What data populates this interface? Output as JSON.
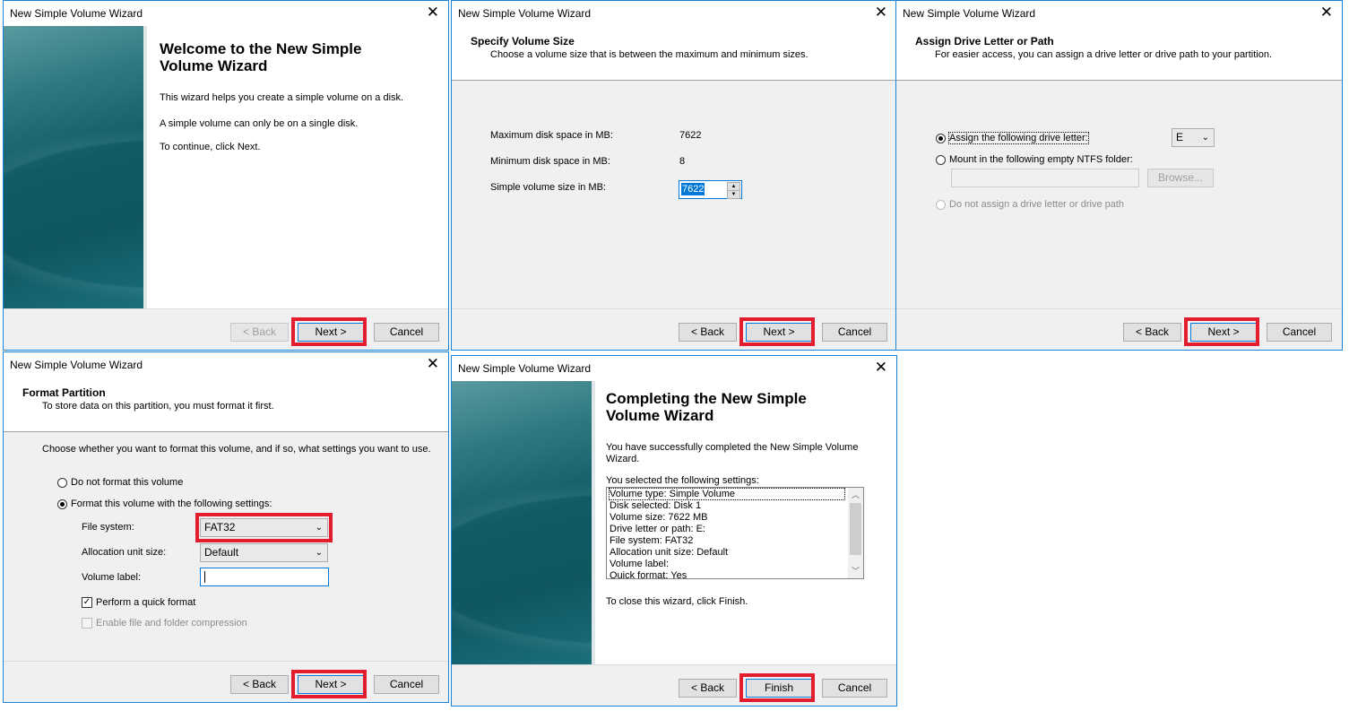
{
  "window_title": "New Simple Volume Wizard",
  "buttons": {
    "back": "< Back",
    "next": "Next >",
    "cancel": "Cancel",
    "finish": "Finish",
    "browse": "Browse..."
  },
  "welcome": {
    "title_line1": "Welcome to the New Simple",
    "title_line2": "Volume Wizard",
    "p1": "This wizard helps you create a simple volume on a disk.",
    "p2": "A simple volume can only be on a single disk.",
    "p3": "To continue, click Next."
  },
  "size": {
    "header": "Specify Volume Size",
    "subheader": "Choose a volume size that is between the maximum and minimum sizes.",
    "max_label": "Maximum disk space in MB:",
    "max_value": "7622",
    "min_label": "Minimum disk space in MB:",
    "min_value": "8",
    "size_label": "Simple volume size in MB:",
    "size_value": "7622"
  },
  "drive": {
    "header": "Assign Drive Letter or Path",
    "subheader": "For easier access, you can assign a drive letter or drive path to your partition.",
    "opt_assign": "Assign the following drive letter:",
    "letter": "E",
    "opt_mount": "Mount in the following empty NTFS folder:",
    "opt_none": "Do not assign a drive letter or drive path"
  },
  "format": {
    "header": "Format Partition",
    "subheader": "To store data on this partition, you must format it first.",
    "intro": "Choose whether you want to format this volume, and if so, what settings you want to use.",
    "opt_no": "Do not format this volume",
    "opt_yes": "Format this volume with the following settings:",
    "fs_label": "File system:",
    "fs_value": "FAT32",
    "alloc_label": "Allocation unit size:",
    "alloc_value": "Default",
    "vol_label": "Volume label:",
    "quick": "Perform a quick format",
    "compress": "Enable file and folder compression"
  },
  "complete": {
    "title_line1": "Completing the New Simple",
    "title_line2": "Volume Wizard",
    "p1_line1": "You have successfully completed the New Simple Volume",
    "p1_line2": "Wizard.",
    "settings_label": "You selected the following settings:",
    "settings": [
      "Volume type: Simple Volume",
      "Disk selected: Disk 1",
      "Volume size: 7622 MB",
      "Drive letter or path: E:",
      "File system: FAT32",
      "Allocation unit size: Default",
      "Volume label:",
      "Quick format: Yes"
    ],
    "close_text": "To close this wizard, click Finish."
  },
  "colors": {
    "highlight": "#e41d2e",
    "accent": "#0078d7",
    "sidebar": "#0f5c66"
  }
}
